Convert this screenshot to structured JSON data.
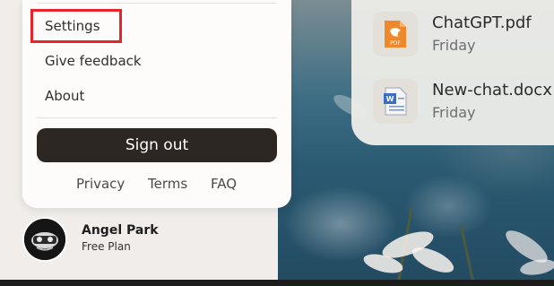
{
  "menu": {
    "items": [
      {
        "label": "Settings"
      },
      {
        "label": "Give feedback"
      },
      {
        "label": "About"
      }
    ],
    "sign_out_label": "Sign out",
    "footer_links": [
      {
        "label": "Privacy"
      },
      {
        "label": "Terms"
      },
      {
        "label": "FAQ"
      }
    ],
    "highlight_color": "#e8242b"
  },
  "user": {
    "name": "Angel Park",
    "plan": "Free Plan"
  },
  "recent_files": [
    {
      "name": "ChatGPT.pdf",
      "date": "Friday",
      "icon": "pdf-file-icon",
      "icon_badge": "PDF",
      "accent": "#f0872a"
    },
    {
      "name": "New-chat.docx",
      "date": "Friday",
      "icon": "word-file-icon",
      "accent": "#3a6fc4"
    }
  ],
  "colors": {
    "page_bg": "#f0edea",
    "sign_out_bg": "#2c2722"
  }
}
